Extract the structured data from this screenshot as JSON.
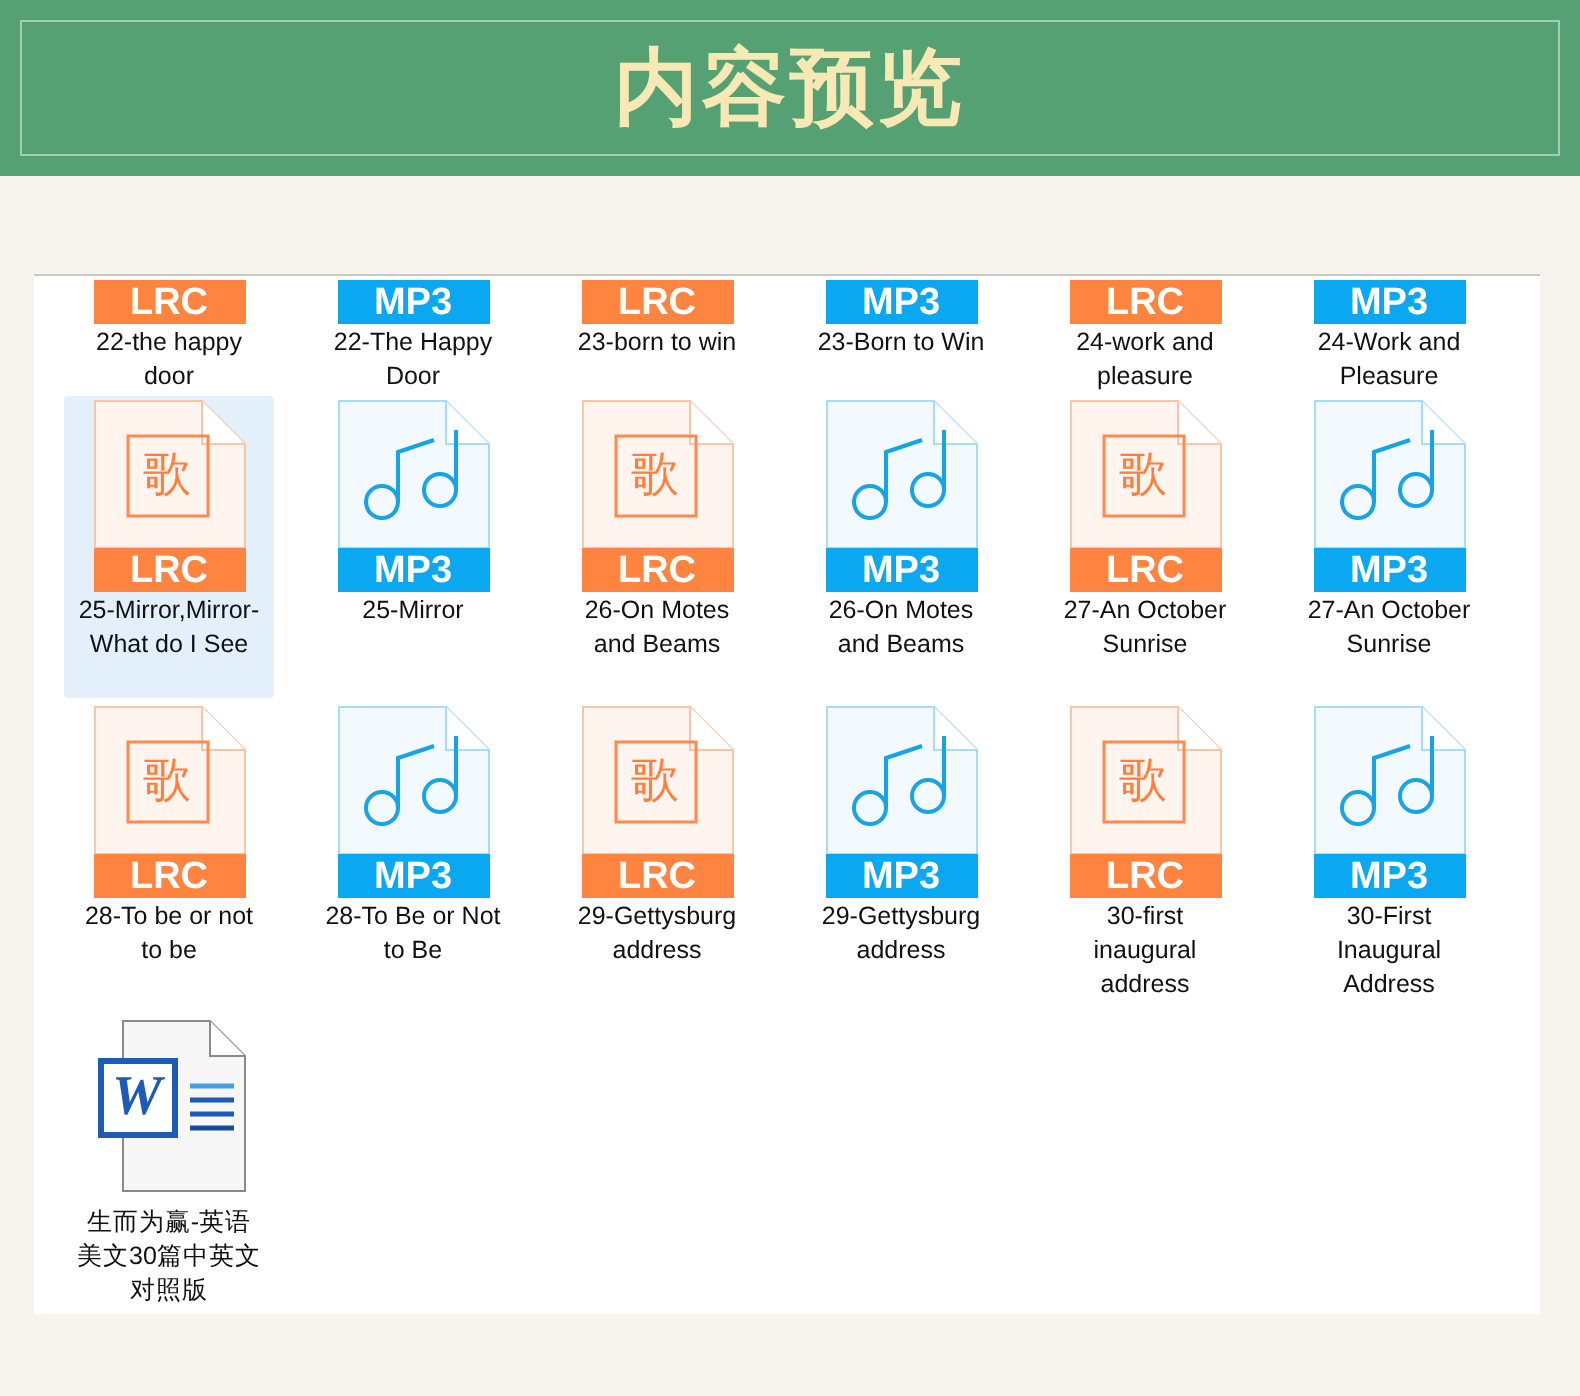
{
  "header": {
    "title": "内容预览"
  },
  "partial_row": [
    {
      "name": "22-the happy door",
      "kind": "lrc",
      "label": "LRC"
    },
    {
      "name": "22-The Happy Door",
      "kind": "mp3",
      "label": "MP3"
    },
    {
      "name": "23-born to win",
      "kind": "lrc",
      "label": "LRC"
    },
    {
      "name": "23-Born to Win",
      "kind": "mp3",
      "label": "MP3"
    },
    {
      "name": "24-work and pleasure",
      "kind": "lrc",
      "label": "LRC"
    },
    {
      "name": "24-Work and Pleasure",
      "kind": "mp3",
      "label": "MP3"
    }
  ],
  "items": [
    {
      "name": "25-Mirror,Mirror-What do I See",
      "kind": "lrc",
      "label": "LRC",
      "glyph": "歌",
      "selected": true
    },
    {
      "name": "25-Mirror",
      "kind": "mp3",
      "label": "MP3",
      "selected": false
    },
    {
      "name": "26-On Motes and Beams",
      "kind": "lrc",
      "label": "LRC",
      "glyph": "歌",
      "selected": false
    },
    {
      "name": "26-On Motes and Beams",
      "kind": "mp3",
      "label": "MP3",
      "selected": false
    },
    {
      "name": "27-An October Sunrise",
      "kind": "lrc",
      "label": "LRC",
      "glyph": "歌",
      "selected": false
    },
    {
      "name": "27-An October Sunrise",
      "kind": "mp3",
      "label": "MP3",
      "selected": false
    },
    {
      "name": "28-To be or not to be",
      "kind": "lrc",
      "label": "LRC",
      "glyph": "歌",
      "selected": false
    },
    {
      "name": "28-To Be or Not to Be",
      "kind": "mp3",
      "label": "MP3",
      "selected": false
    },
    {
      "name": "29-Gettysburg address",
      "kind": "lrc",
      "label": "LRC",
      "glyph": "歌",
      "selected": false
    },
    {
      "name": "29-Gettysburg address",
      "kind": "mp3",
      "label": "MP3",
      "selected": false
    },
    {
      "name": "30-first inaugural address",
      "kind": "lrc",
      "label": "LRC",
      "glyph": "歌",
      "selected": false
    },
    {
      "name": "30-First Inaugural Address",
      "kind": "mp3",
      "label": "MP3",
      "selected": false
    },
    {
      "name": "生而为赢-英语美文30篇中英文对照版",
      "kind": "doc",
      "badge": "W",
      "selected": false
    }
  ]
}
